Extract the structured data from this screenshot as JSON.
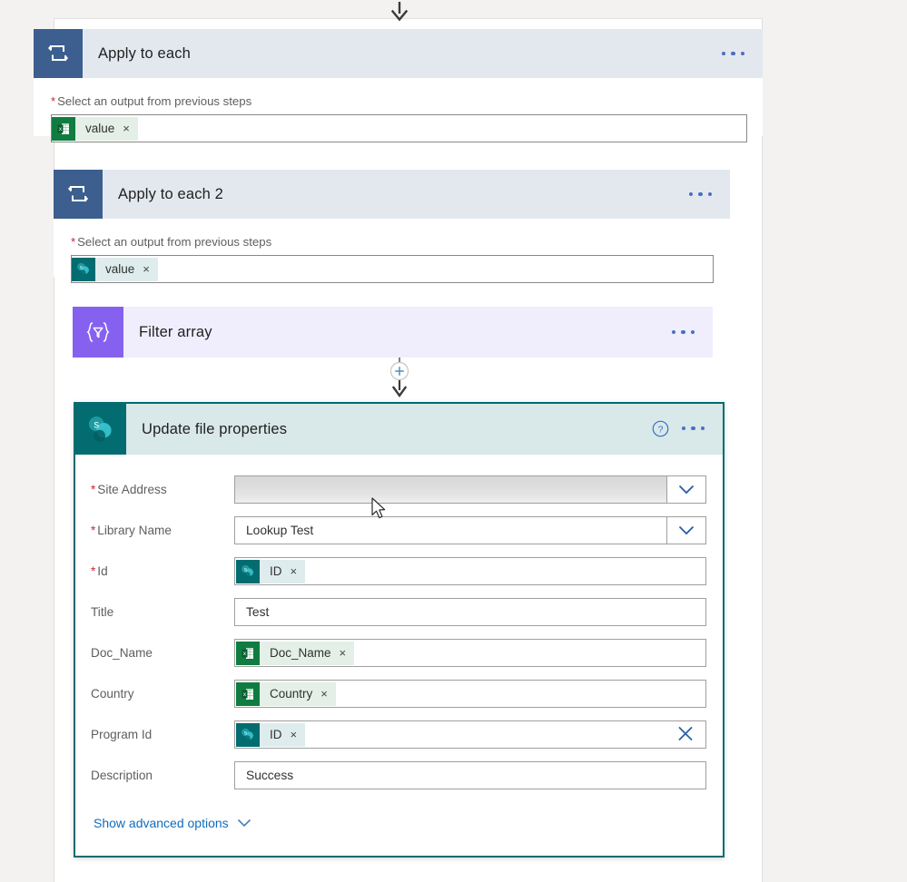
{
  "canvas": {
    "background_color": "#f3f2f1",
    "top_connector_icon": "arrow-down-icon"
  },
  "apply_to_each_1": {
    "title": "Apply to each",
    "icon": "loop-icon",
    "icon_color": "#3c5f8f",
    "header_color": "#e3e8ef",
    "more_label": "...",
    "field": {
      "label": "Select an output from previous steps",
      "required": true,
      "token": {
        "text": "value",
        "source": "excel-icon",
        "remove": "×"
      }
    }
  },
  "apply_to_each_2": {
    "title": "Apply to each 2",
    "icon": "loop-icon",
    "icon_color": "#3c5f8f",
    "header_color": "#e3e8ef",
    "more_label": "...",
    "field": {
      "label": "Select an output from previous steps",
      "required": true,
      "token": {
        "text": "value",
        "source": "sharepoint-icon",
        "remove": "×"
      }
    }
  },
  "filter_array": {
    "title": "Filter array",
    "icon": "filter-braces-icon",
    "icon_glyph": "{▽}",
    "icon_color": "#8661f0",
    "header_color": "#f0eefc",
    "more_label": "..."
  },
  "connector": {
    "plus_label": "+",
    "arrow_icon": "arrow-down-icon"
  },
  "update_file_properties": {
    "title": "Update file properties",
    "icon": "sharepoint-icon",
    "icon_color": "#036c70",
    "header_color": "#d9e8e9",
    "border_color": "#036c70",
    "help_label": "?",
    "more_label": "...",
    "fields": [
      {
        "label": "Site Address",
        "required": true,
        "type": "dropdown-redacted",
        "value": "",
        "chevron": "chevron-down-icon"
      },
      {
        "label": "Library Name",
        "required": true,
        "type": "dropdown",
        "value": "Lookup Test",
        "chevron": "chevron-down-icon"
      },
      {
        "label": "Id",
        "required": true,
        "type": "token",
        "token": {
          "text": "ID",
          "source": "sharepoint-icon",
          "remove": "×"
        }
      },
      {
        "label": "Title",
        "required": false,
        "type": "text",
        "value": "Test"
      },
      {
        "label": "Doc_Name",
        "required": false,
        "type": "token",
        "token": {
          "text": "Doc_Name",
          "source": "excel-icon",
          "remove": "×"
        }
      },
      {
        "label": "Country",
        "required": false,
        "type": "token",
        "token": {
          "text": "Country",
          "source": "excel-icon",
          "remove": "×"
        }
      },
      {
        "label": "Program Id",
        "required": false,
        "type": "token-clearable",
        "token": {
          "text": "ID",
          "source": "sharepoint-icon",
          "remove": "×"
        },
        "clear": "clear-x-icon"
      },
      {
        "label": "Description",
        "required": false,
        "type": "text",
        "value": "Success"
      }
    ],
    "advanced_options": {
      "label": "Show advanced options",
      "chevron": "chevron-down-icon"
    }
  },
  "colors": {
    "sharepoint_teal": "#036c70",
    "excel_green": "#107c41",
    "loop_blue": "#3c5f8f",
    "filter_purple": "#8661f0",
    "accent_link": "#0f6cbd",
    "required_red": "#c9253b"
  }
}
